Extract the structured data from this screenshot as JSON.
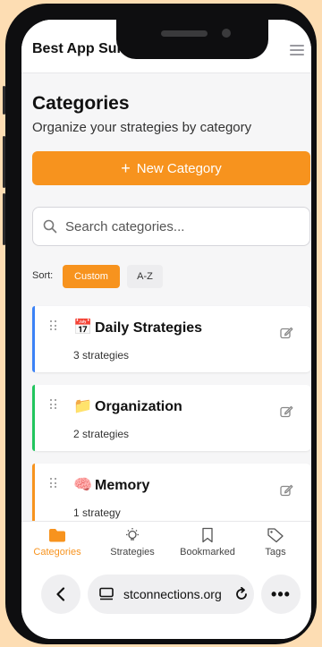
{
  "header": {
    "brand": "Best App Suite"
  },
  "page": {
    "title": "Categories",
    "subtitle": "Organize your strategies by category"
  },
  "actions": {
    "new_category_label": "New Category"
  },
  "search": {
    "placeholder": "Search categories..."
  },
  "sort": {
    "label": "Sort:",
    "options": [
      "Custom",
      "A-Z"
    ],
    "selected": "Custom"
  },
  "categories": [
    {
      "emoji": "📅",
      "name": "Daily Strategies",
      "count": "3 strategies",
      "accent": "#3B82F6"
    },
    {
      "emoji": "📁",
      "name": "Organization",
      "count": "2 strategies",
      "accent": "#22C55E"
    },
    {
      "emoji": "🧠",
      "name": "Memory",
      "count": "1 strategy",
      "accent": "#F7931E"
    }
  ],
  "bottom_nav": [
    {
      "label": "Categories",
      "icon": "folder-icon",
      "active": true
    },
    {
      "label": "Strategies",
      "icon": "lightbulb-icon",
      "active": false
    },
    {
      "label": "Bookmarked",
      "icon": "bookmark-icon",
      "active": false
    },
    {
      "label": "Tags",
      "icon": "tag-icon",
      "active": false
    }
  ],
  "browser": {
    "url": "stconnections.org"
  },
  "colors": {
    "accent": "#F7931E",
    "background": "#FDDDB3"
  }
}
